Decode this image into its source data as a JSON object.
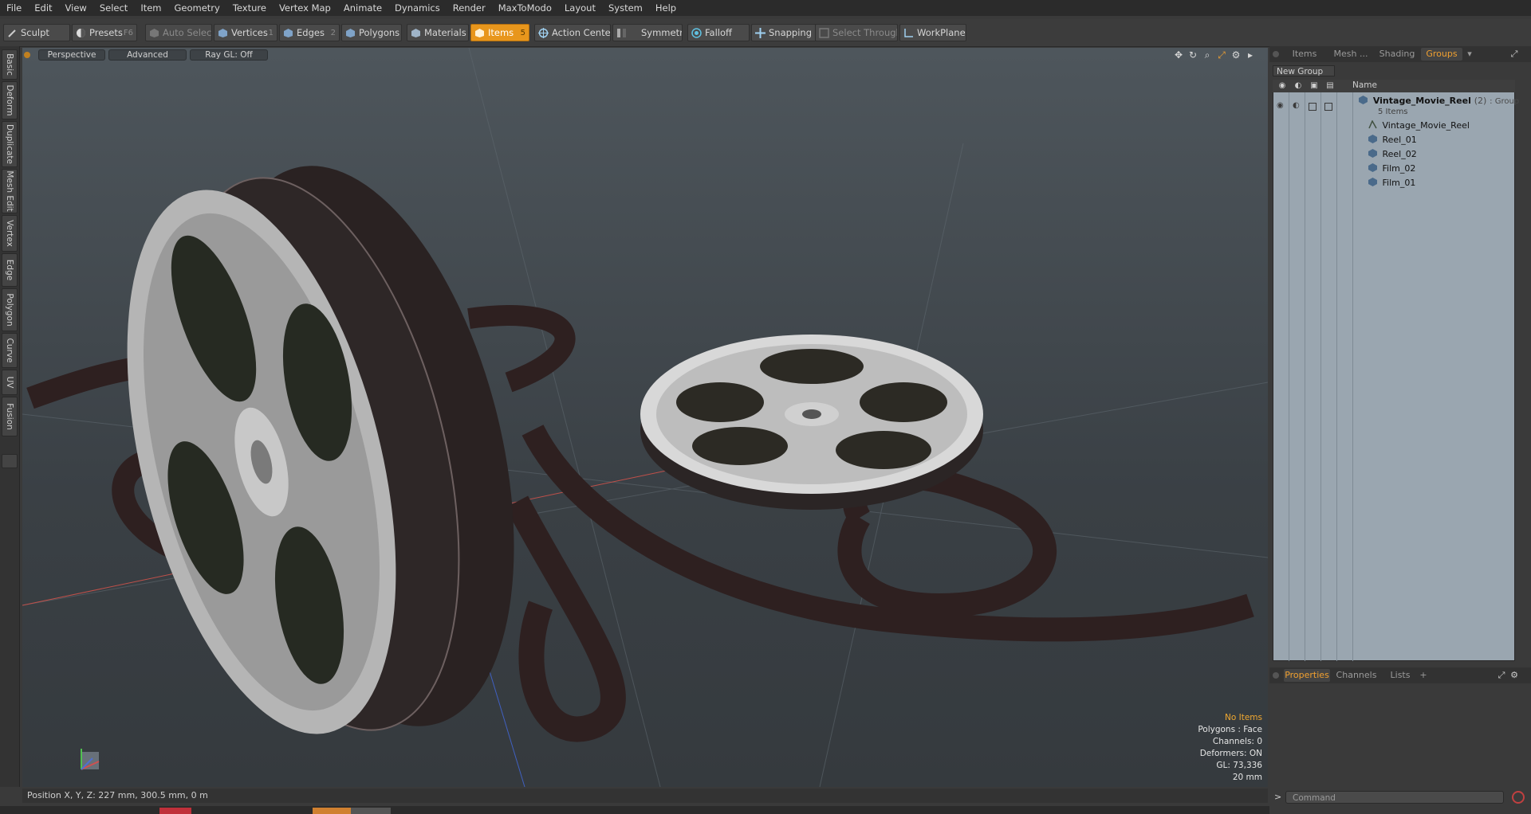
{
  "menu": [
    "File",
    "Edit",
    "View",
    "Select",
    "Item",
    "Geometry",
    "Texture",
    "Vertex Map",
    "Animate",
    "Dynamics",
    "Render",
    "MaxToModo",
    "Layout",
    "System",
    "Help"
  ],
  "toolbar": {
    "sculpt": "Sculpt",
    "presets": "Presets",
    "presets_key": "F6",
    "auto_select": "Auto Select",
    "vertices": "Vertices",
    "vertices_key": "1",
    "edges": "Edges",
    "edges_key": "2",
    "polygons": "Polygons",
    "materials": "Materials",
    "items": "Items",
    "items_key": "5",
    "action_center": "Action Center",
    "symmetry": "Symmetry",
    "falloff": "Falloff",
    "snapping": "Snapping",
    "select_through": "Select Through",
    "workplane": "WorkPlane"
  },
  "left_tabs": [
    "Basic",
    "Deform",
    "Duplicate",
    "Mesh Edit",
    "Vertex",
    "Edge",
    "Polygon",
    "Curve",
    "UV",
    "Fusion"
  ],
  "viewport": {
    "view_mode": "Perspective",
    "shading": "Advanced",
    "raygl": "Ray GL: Off",
    "info": {
      "selection": "No Items",
      "polygons": "Polygons : Face",
      "channels": "Channels: 0",
      "deformers": "Deformers: ON",
      "gl": "GL: 73,336",
      "scale": "20 mm"
    }
  },
  "status": {
    "position": "Position X, Y, Z:  227 mm, 300.5 mm, 0 m"
  },
  "right_panel": {
    "tabs": [
      "Items",
      "Mesh ...",
      "Shading",
      "Groups"
    ],
    "active_tab": "Groups",
    "new_group": "New Group",
    "column_name": "Name",
    "group": {
      "name": "Vintage_Movie_Reel",
      "count": "(2)",
      "type": ": Group",
      "sub": "5 Items"
    },
    "children": [
      "Vintage_Movie_Reel",
      "Reel_01",
      "Reel_02",
      "Film_02",
      "Film_01"
    ],
    "bottom_tabs": [
      "Properties",
      "Channels",
      "Lists",
      "+"
    ],
    "command_placeholder": "Command"
  },
  "colors": {
    "accent": "#e8961c",
    "active_tab_text": "#f0a030",
    "list_bg": "#9aa6b0"
  }
}
